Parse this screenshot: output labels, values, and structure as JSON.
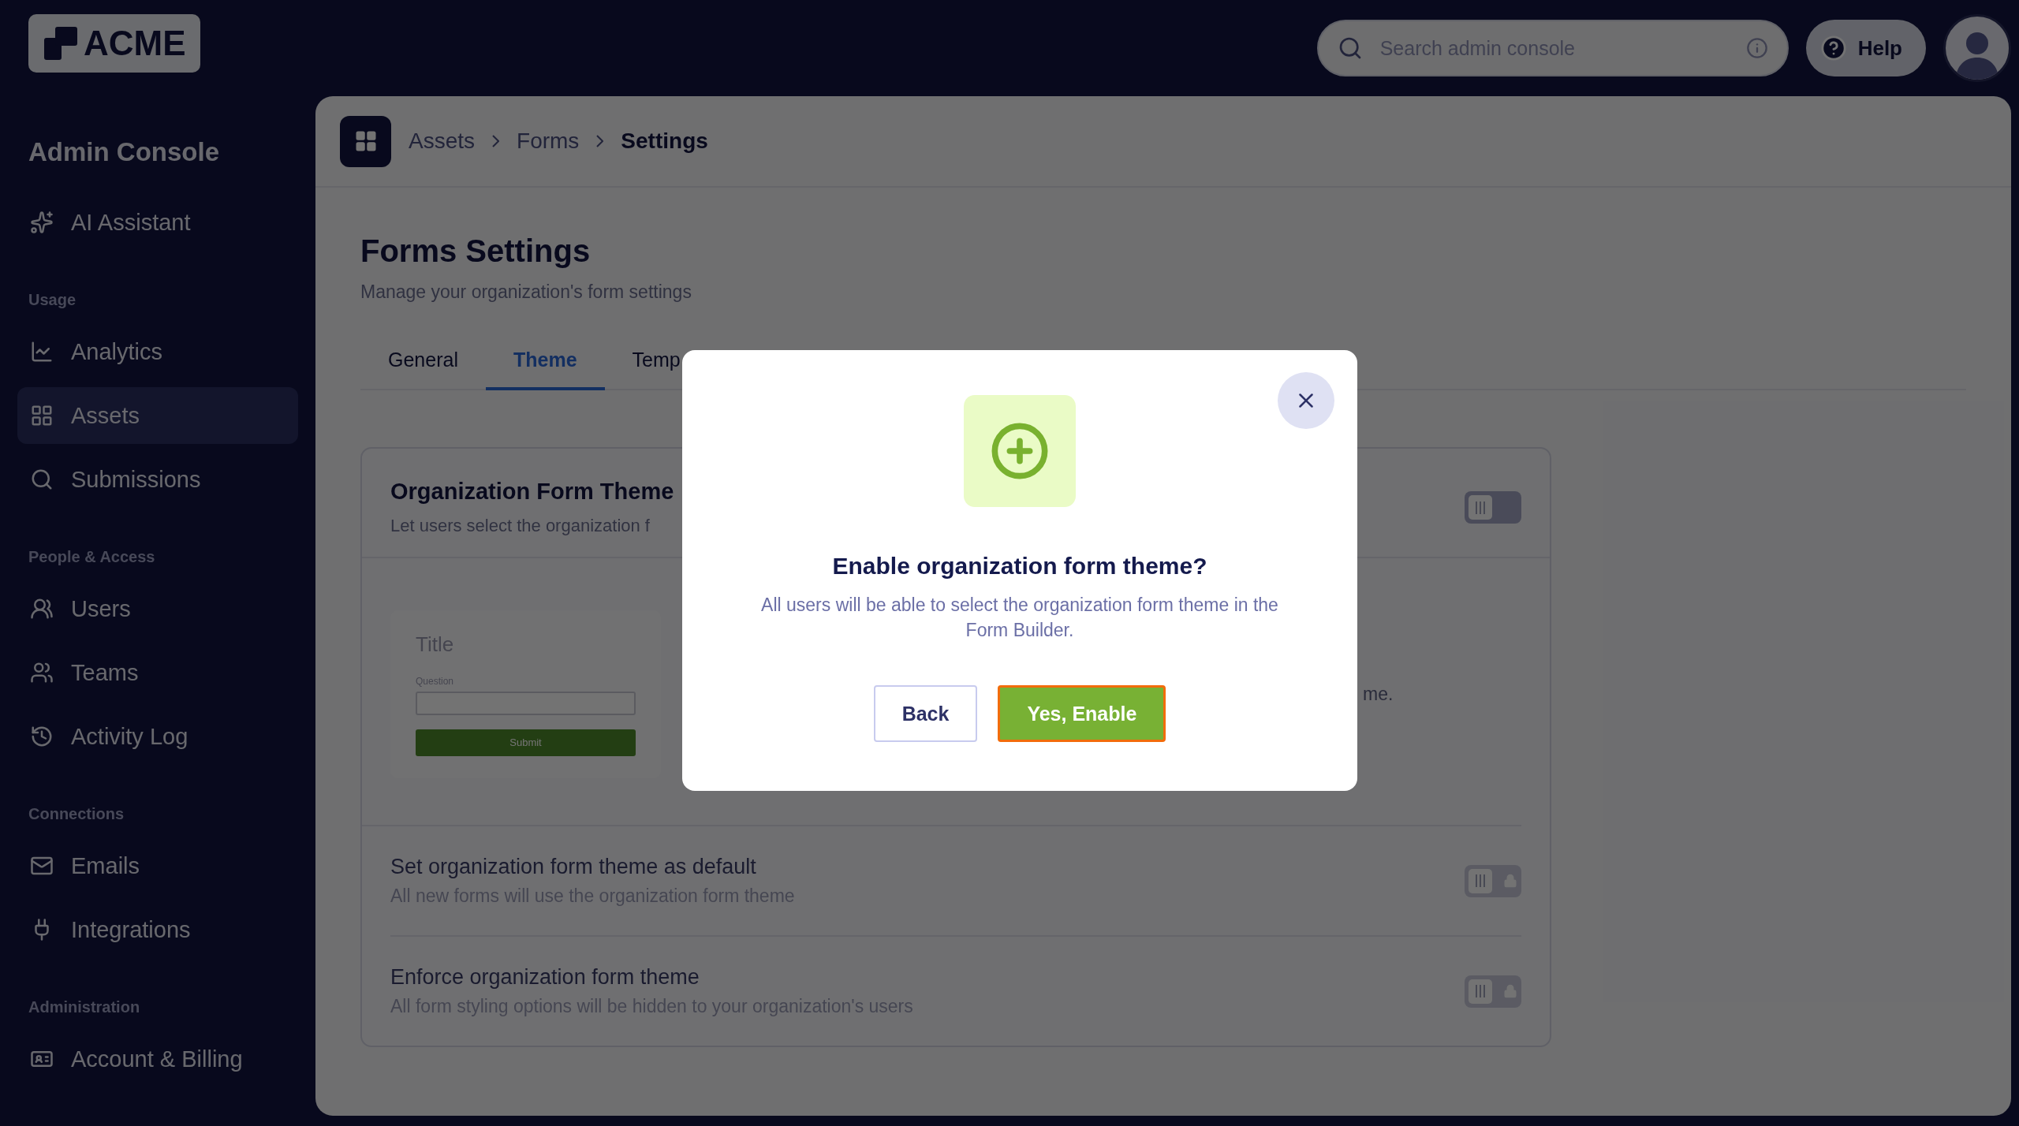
{
  "logo": {
    "text": "ACME"
  },
  "sidebar": {
    "title": "Admin Console",
    "sections": [
      {
        "items": [
          {
            "label": "AI Assistant",
            "selected": false
          }
        ]
      },
      {
        "label": "Usage",
        "items": [
          {
            "label": "Analytics",
            "selected": false
          },
          {
            "label": "Assets",
            "selected": true
          },
          {
            "label": "Submissions",
            "selected": false
          }
        ]
      },
      {
        "label": "People & Access",
        "items": [
          {
            "label": "Users",
            "selected": false
          },
          {
            "label": "Teams",
            "selected": false
          },
          {
            "label": "Activity Log",
            "selected": false
          }
        ]
      },
      {
        "label": "Connections",
        "items": [
          {
            "label": "Emails",
            "selected": false
          },
          {
            "label": "Integrations",
            "selected": false
          }
        ]
      },
      {
        "label": "Administration",
        "items": [
          {
            "label": "Account & Billing",
            "selected": false
          }
        ]
      }
    ]
  },
  "header": {
    "search": {
      "placeholder": "Search admin console"
    },
    "help": "Help"
  },
  "breadcrumb": [
    "Assets",
    "Forms",
    "Settings"
  ],
  "page": {
    "title": "Forms Settings",
    "subtitle": "Manage your organization's form settings",
    "tabs": [
      {
        "label": "General",
        "selected": false
      },
      {
        "label": "Theme",
        "selected": true
      },
      {
        "label": "Temp",
        "selected": false
      }
    ]
  },
  "card": {
    "title": "Organization Form Theme",
    "subtitle": "Let users select the organization f",
    "toggle": {
      "on": false,
      "locked": false
    },
    "preview": {
      "title": "Title",
      "question": "Question",
      "submit": "Submit",
      "note": "me."
    },
    "rows": [
      {
        "title": "Set organization form theme as default",
        "subtitle": "All new forms will use the organization form theme",
        "toggle": {
          "on": false,
          "locked": true
        }
      },
      {
        "title": "Enforce organization form theme",
        "subtitle": "All form styling options will be hidden to your organization's users",
        "toggle": {
          "on": false,
          "locked": true
        }
      }
    ]
  },
  "dialog": {
    "title": "Enable organization form theme?",
    "body": "All users will be able to select the organization form theme in the Form Builder.",
    "buttons": [
      {
        "label": "Back",
        "kind": "secondary",
        "focused": false
      },
      {
        "label": "Yes, Enable",
        "kind": "primary",
        "focused": true
      }
    ]
  }
}
